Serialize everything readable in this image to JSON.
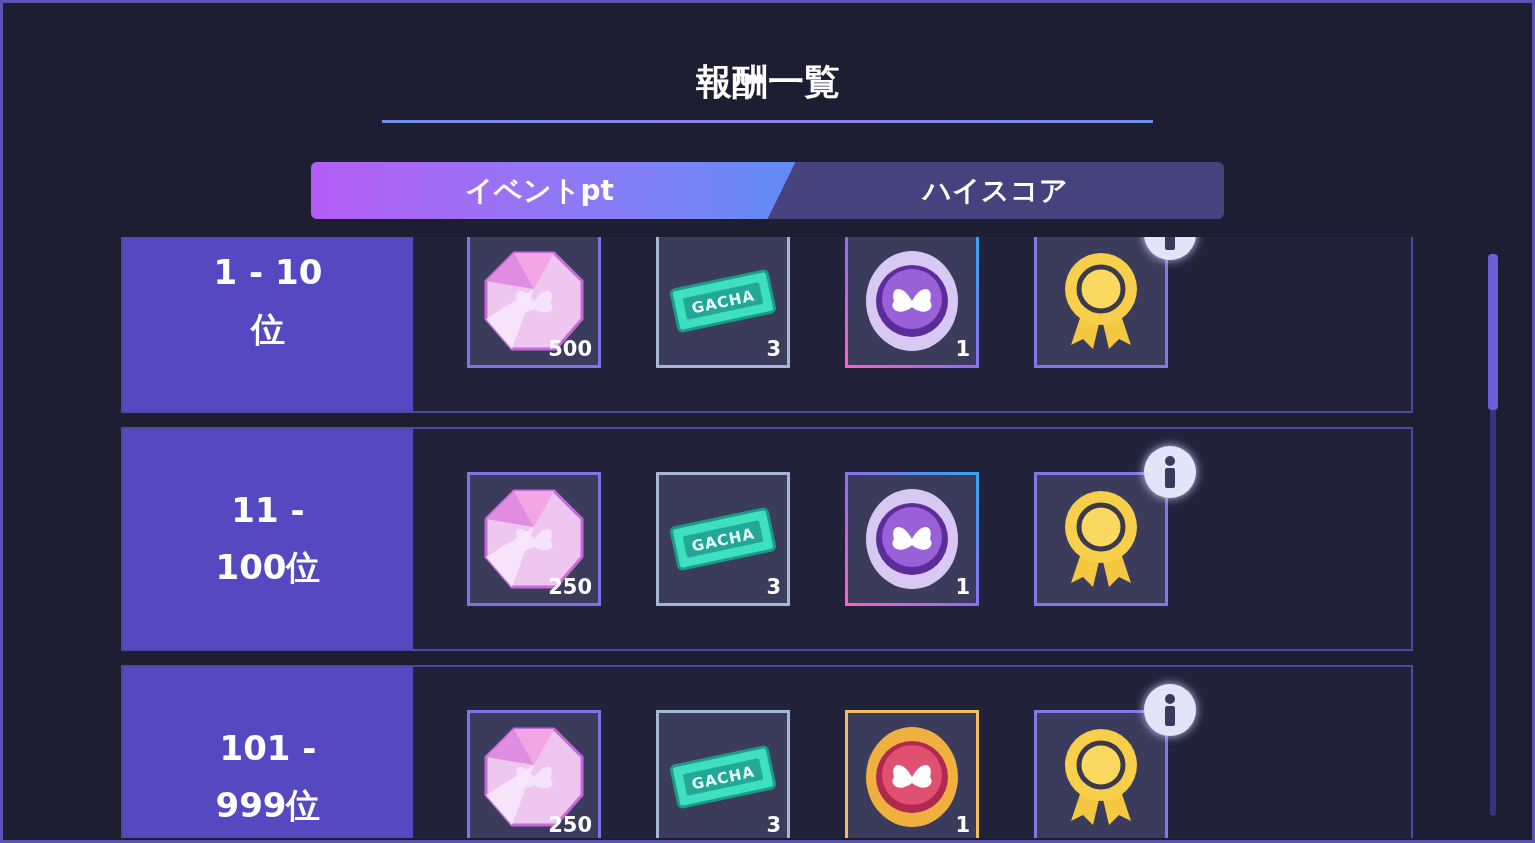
{
  "title": "報酬一覧",
  "tabs": [
    {
      "label": "イベントpt",
      "selected": true
    },
    {
      "label": "ハイスコア",
      "selected": false
    }
  ],
  "tiers": [
    {
      "rank": "1 - 10位",
      "rewards": [
        {
          "kind": "gem",
          "count": "500"
        },
        {
          "kind": "ticket",
          "label": "GACHA",
          "count": "3"
        },
        {
          "kind": "brooch",
          "count": "1"
        },
        {
          "kind": "medal",
          "info": true
        }
      ]
    },
    {
      "rank": "11 - 100位",
      "rewards": [
        {
          "kind": "gem",
          "count": "250"
        },
        {
          "kind": "ticket",
          "label": "GACHA",
          "count": "3"
        },
        {
          "kind": "brooch",
          "count": "1"
        },
        {
          "kind": "medal",
          "info": true
        }
      ]
    },
    {
      "rank": "101 - 999位",
      "rewards": [
        {
          "kind": "gem",
          "count": "250"
        },
        {
          "kind": "ticket",
          "label": "GACHA",
          "count": "3"
        },
        {
          "kind": "cameo",
          "count": "1"
        },
        {
          "kind": "medal",
          "info": true
        }
      ]
    }
  ]
}
